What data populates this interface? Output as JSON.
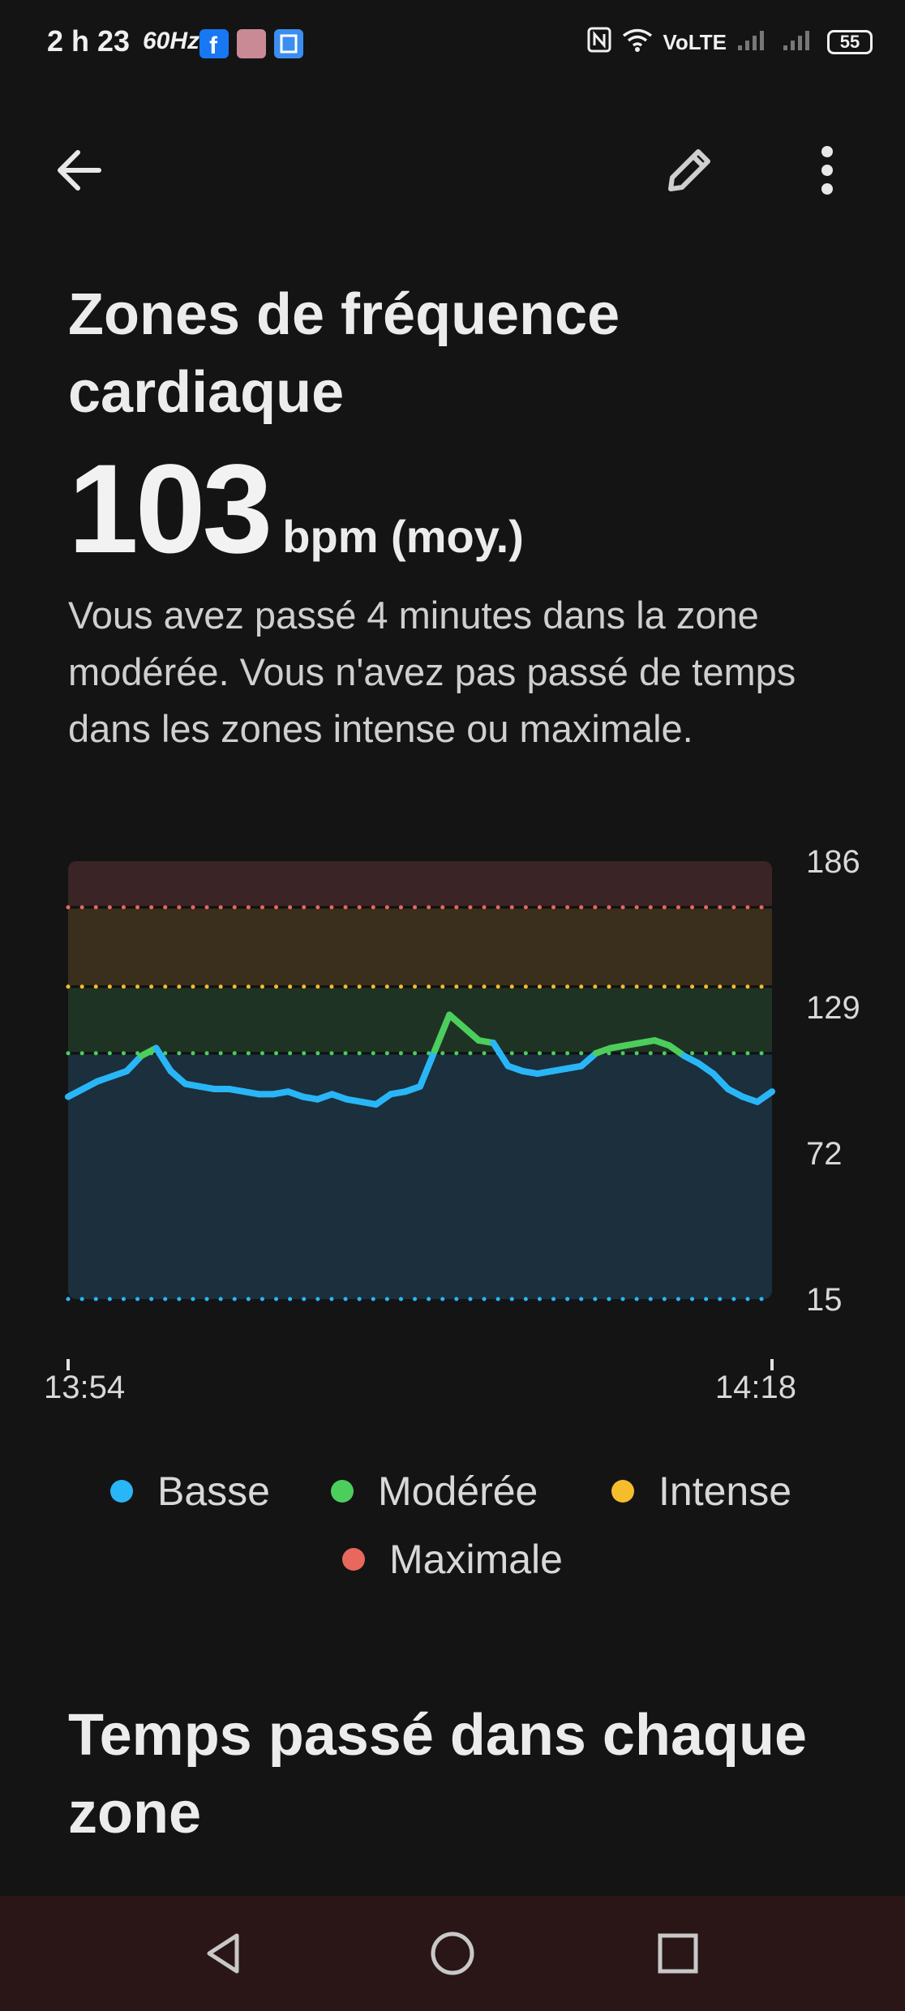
{
  "status_bar": {
    "time": "2 h 23",
    "refresh_rate": "60Hz",
    "network": "VoLTE",
    "battery": "55"
  },
  "app_bar": {
    "back_icon": "arrow-left-icon",
    "edit_icon": "pencil-icon",
    "more_icon": "more-vert-icon"
  },
  "page": {
    "title": "Zones de fréquence cardiaque",
    "average_value": "103",
    "average_unit": "bpm (moy.)",
    "summary": "Vous avez passé 4 minutes dans la zone modérée. Vous n'avez pas passé de temps dans les zones intense ou maximale.",
    "section_title": "Temps passé dans chaque zone"
  },
  "chart_data": {
    "type": "line",
    "x_start": "13:54",
    "x_end": "14:18",
    "x_ticks": [
      "13:54",
      "14:18"
    ],
    "y_ticks": [
      "186",
      "129",
      "72",
      "15"
    ],
    "ylim": [
      15,
      186
    ],
    "zones": [
      {
        "name": "Basse",
        "from": 15,
        "to": 111,
        "color": "#29b6f6"
      },
      {
        "name": "Modérée",
        "from": 111,
        "to": 137,
        "color": "#4cce5c"
      },
      {
        "name": "Intense",
        "from": 137,
        "to": 168,
        "color": "#f5bd2b"
      },
      {
        "name": "Maximale",
        "from": 168,
        "to": 186,
        "color": "#e8685e"
      }
    ],
    "series": [
      {
        "x_minutes": [
          0,
          0.5,
          1,
          1.5,
          2,
          2.5,
          3,
          3.5,
          4,
          4.5,
          5,
          5.5,
          6,
          6.5,
          7,
          7.5,
          8,
          8.5,
          9,
          9.5,
          10,
          10.5,
          11,
          11.5,
          12,
          12.5,
          13,
          13.5,
          14,
          14.5,
          15,
          15.5,
          16,
          16.5,
          17,
          17.5,
          18,
          18.5,
          19,
          19.5,
          20,
          20.5,
          21,
          21.5,
          22,
          22.5,
          23,
          23.5,
          24
        ],
        "values": [
          94,
          97,
          100,
          102,
          104,
          110,
          113,
          104,
          99,
          98,
          97,
          97,
          96,
          95,
          95,
          96,
          94,
          93,
          95,
          93,
          92,
          91,
          95,
          96,
          98,
          112,
          126,
          121,
          116,
          115,
          106,
          104,
          103,
          104,
          105,
          106,
          111,
          113,
          114,
          115,
          116,
          114,
          110,
          107,
          103,
          97,
          94,
          92,
          96
        ]
      }
    ],
    "grid": false,
    "legend_position": "bottom"
  },
  "legend": [
    {
      "label": "Basse",
      "color": "#29b6f6"
    },
    {
      "label": "Modérée",
      "color": "#4cce5c"
    },
    {
      "label": "Intense",
      "color": "#f5bd2b"
    },
    {
      "label": "Maximale",
      "color": "#e8685e"
    }
  ],
  "nav_bar": {
    "back_icon": "triangle-back-icon",
    "home_icon": "circle-home-icon",
    "recents_icon": "square-recents-icon"
  }
}
